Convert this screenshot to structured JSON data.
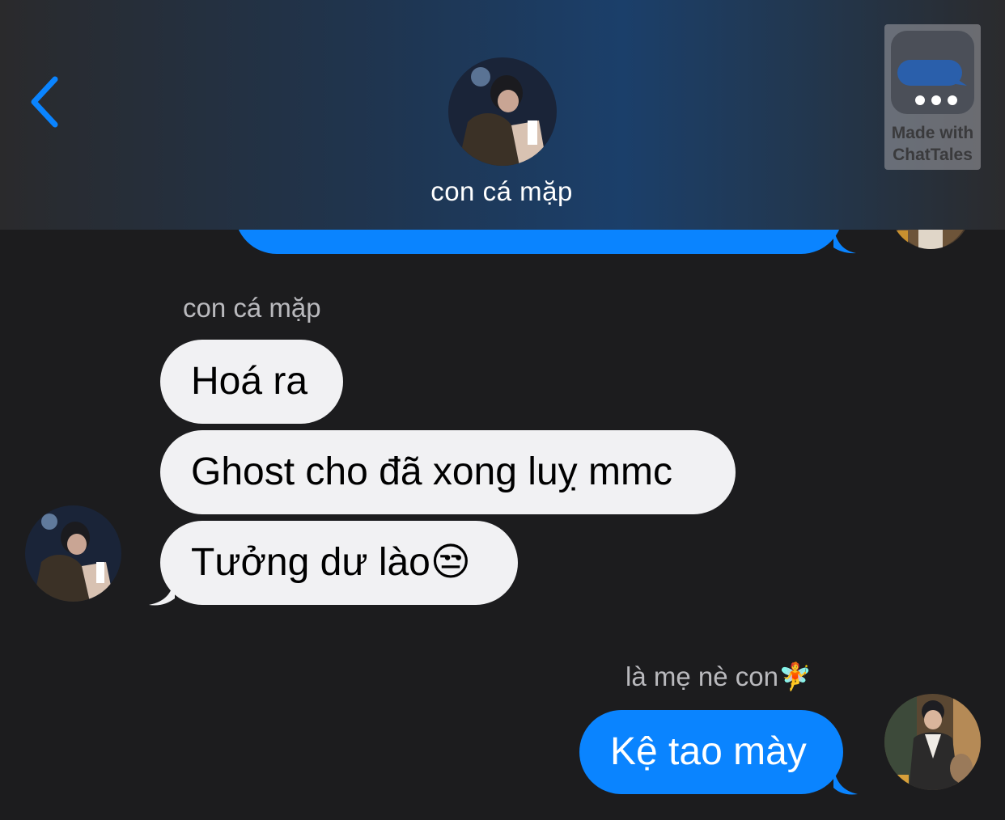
{
  "header": {
    "title": "con cá mặp",
    "back_icon": "chevron-left-icon",
    "watermark": {
      "line1": "Made with",
      "line2": "ChatTales"
    }
  },
  "messages": {
    "incoming_sender": "con cá mặp",
    "incoming": [
      "Hoá ra",
      "Ghost cho đã xong luỵ mmc",
      "Tưởng dư lào😒"
    ],
    "outgoing_sender": "là mẹ nè con🧚",
    "outgoing": [
      "Kệ tao mày"
    ]
  },
  "colors": {
    "background": "#1c1c1e",
    "outgoing_bubble": "#0a84ff",
    "incoming_bubble": "#f1f1f3",
    "accent": "#0a84ff"
  }
}
